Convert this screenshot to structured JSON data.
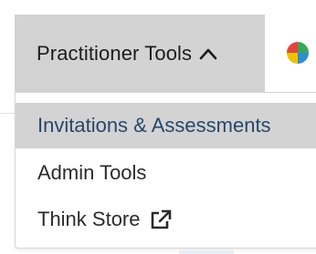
{
  "nav": {
    "active_item": {
      "label": "Practitioner Tools",
      "icon": "chevron-up-icon",
      "expanded": true
    },
    "brand_icon": "color-wheel-icon",
    "colors": {
      "active_bg": "#d3d3d3",
      "highlight_text": "#27476b"
    }
  },
  "dropdown": {
    "items": [
      {
        "label": "Invitations & Assessments",
        "highlighted": true
      },
      {
        "label": "Admin Tools",
        "highlighted": false
      },
      {
        "label": "Think Store",
        "icon": "external-link-icon",
        "highlighted": false
      }
    ]
  }
}
